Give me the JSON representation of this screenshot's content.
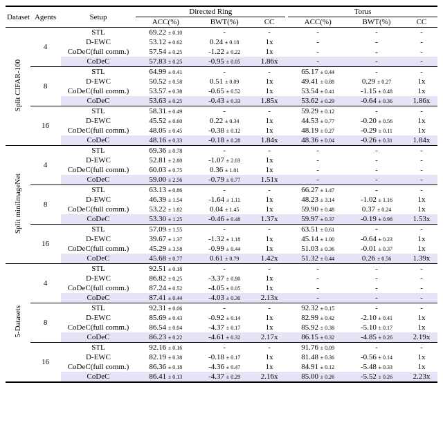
{
  "header": {
    "dataset": "Dataset",
    "agents": "Agents",
    "setup": "Setup",
    "directed_ring": "Directed Ring",
    "torus": "Torus",
    "acc": "ACC(%)",
    "bwt": "BWT(%)",
    "cc": "CC"
  },
  "setups": {
    "stl": "STL",
    "dewc": "D-EWC",
    "codecfull": "CoDeC(full comm.)",
    "codec": "CoDeC"
  },
  "datasets": [
    {
      "name": "Split CIFAR-100",
      "groups": [
        {
          "agents": "4",
          "rows": [
            {
              "setup": "stl",
              "dr_acc": "69.22",
              "dr_acc_pm": "± 0.10",
              "dr_bwt": "-",
              "dr_bwt_pm": "",
              "dr_cc": "-",
              "t_acc": "-",
              "t_acc_pm": "",
              "t_bwt": "-",
              "t_bwt_pm": "",
              "t_cc": "-"
            },
            {
              "setup": "dewc",
              "dr_acc": "53.12",
              "dr_acc_pm": "± 0.62",
              "dr_bwt": "0.24",
              "dr_bwt_pm": "± 0.18",
              "dr_cc": "1x",
              "t_acc": "-",
              "t_acc_pm": "",
              "t_bwt": "-",
              "t_bwt_pm": "",
              "t_cc": "-"
            },
            {
              "setup": "codecfull",
              "dr_acc": "57.54",
              "dr_acc_pm": "± 0.25",
              "dr_bwt": "-1.22",
              "dr_bwt_pm": "± 0.22",
              "dr_cc": "1x",
              "t_acc": "-",
              "t_acc_pm": "",
              "t_bwt": "-",
              "t_bwt_pm": "",
              "t_cc": "-"
            },
            {
              "setup": "codec",
              "hl": true,
              "dr_acc": "57.83",
              "dr_acc_pm": "± 0.25",
              "dr_bwt": "-0.95",
              "dr_bwt_pm": "± 0.05",
              "dr_cc": "1.86x",
              "t_acc": "-",
              "t_acc_pm": "",
              "t_bwt": "-",
              "t_bwt_pm": "",
              "t_cc": "-"
            }
          ]
        },
        {
          "agents": "8",
          "rows": [
            {
              "setup": "stl",
              "dr_acc": "64.99",
              "dr_acc_pm": "± 0.41",
              "dr_bwt": "-",
              "dr_bwt_pm": "",
              "dr_cc": "-",
              "t_acc": "65.17",
              "t_acc_pm": "± 0.44",
              "t_bwt": "-",
              "t_bwt_pm": "",
              "t_cc": "-"
            },
            {
              "setup": "dewc",
              "dr_acc": "50.52",
              "dr_acc_pm": "± 0.58",
              "dr_bwt": "0.51",
              "dr_bwt_pm": "± 0.09",
              "dr_cc": "1x",
              "t_acc": "49.41",
              "t_acc_pm": "± 0.88",
              "t_bwt": "0.29",
              "t_bwt_pm": "± 0.27",
              "t_cc": "1x"
            },
            {
              "setup": "codecfull",
              "dr_acc": "53.57",
              "dr_acc_pm": "± 0.38",
              "dr_bwt": "-0.65",
              "dr_bwt_pm": "± 0.52",
              "dr_cc": "1x",
              "t_acc": "53.54",
              "t_acc_pm": "± 0.41",
              "t_bwt": "-1.15",
              "t_bwt_pm": "± 0.48",
              "t_cc": "1x"
            },
            {
              "setup": "codec",
              "hl": true,
              "dr_acc": "53.63",
              "dr_acc_pm": "± 0.25",
              "dr_bwt": "-0.43",
              "dr_bwt_pm": "± 0.33",
              "dr_cc": "1.85x",
              "t_acc": "53.62",
              "t_acc_pm": "± 0.29",
              "t_bwt": "-0.64",
              "t_bwt_pm": "± 0.36",
              "t_cc": "1.86x"
            }
          ]
        },
        {
          "agents": "16",
          "rows": [
            {
              "setup": "stl",
              "dr_acc": "58.31",
              "dr_acc_pm": "± 0.49",
              "dr_bwt": "-",
              "dr_bwt_pm": "",
              "dr_cc": "-",
              "t_acc": "59.29",
              "t_acc_pm": "± 0.12",
              "t_bwt": "-",
              "t_bwt_pm": "",
              "t_cc": "-"
            },
            {
              "setup": "dewc",
              "dr_acc": "45.52",
              "dr_acc_pm": "± 0.60",
              "dr_bwt": "0.22",
              "dr_bwt_pm": "± 0.34",
              "dr_cc": "1x",
              "t_acc": "44.53",
              "t_acc_pm": "± 0.77",
              "t_bwt": "-0.20",
              "t_bwt_pm": "± 0.56",
              "t_cc": "1x"
            },
            {
              "setup": "codecfull",
              "dr_acc": "48.05",
              "dr_acc_pm": "± 0.45",
              "dr_bwt": "-0.38",
              "dr_bwt_pm": "± 0.12",
              "dr_cc": "1x",
              "t_acc": "48.19",
              "t_acc_pm": "± 0.27",
              "t_bwt": "-0.29",
              "t_bwt_pm": "± 0.11",
              "t_cc": "1x"
            },
            {
              "setup": "codec",
              "hl": true,
              "dr_acc": "48.16",
              "dr_acc_pm": "± 0.33",
              "dr_bwt": "-0.18",
              "dr_bwt_pm": "± 0.28",
              "dr_cc": "1.84x",
              "t_acc": "48.36",
              "t_acc_pm": "± 0.04",
              "t_bwt": "-0.26",
              "t_bwt_pm": "± 0.31",
              "t_cc": "1.84x"
            }
          ]
        }
      ]
    },
    {
      "name": "Split miniImageNet",
      "groups": [
        {
          "agents": "4",
          "rows": [
            {
              "setup": "stl",
              "dr_acc": "69.36",
              "dr_acc_pm": "± 0.78",
              "dr_bwt": "-",
              "dr_bwt_pm": "",
              "dr_cc": "-",
              "t_acc": "-",
              "t_acc_pm": "",
              "t_bwt": "-",
              "t_bwt_pm": "",
              "t_cc": "-"
            },
            {
              "setup": "dewc",
              "dr_acc": "52.81",
              "dr_acc_pm": "± 2.80",
              "dr_bwt": "-1.07",
              "dr_bwt_pm": "± 2.03",
              "dr_cc": "1x",
              "t_acc": "-",
              "t_acc_pm": "",
              "t_bwt": "-",
              "t_bwt_pm": "",
              "t_cc": "-"
            },
            {
              "setup": "codecfull",
              "dr_acc": "60.03",
              "dr_acc_pm": "± 0.75",
              "dr_bwt": "0.36",
              "dr_bwt_pm": "± 1.01",
              "dr_cc": "1x",
              "t_acc": "-",
              "t_acc_pm": "",
              "t_bwt": "-",
              "t_bwt_pm": "",
              "t_cc": "-"
            },
            {
              "setup": "codec",
              "hl": true,
              "dr_acc": "59.00",
              "dr_acc_pm": "± 2.56",
              "dr_bwt": "-0.79",
              "dr_bwt_pm": "± 0.77",
              "dr_cc": "1.51x",
              "t_acc": "-",
              "t_acc_pm": "",
              "t_bwt": "-",
              "t_bwt_pm": "",
              "t_cc": "-"
            }
          ]
        },
        {
          "agents": "8",
          "rows": [
            {
              "setup": "stl",
              "dr_acc": "63.13",
              "dr_acc_pm": "± 0.86",
              "dr_bwt": "-",
              "dr_bwt_pm": "",
              "dr_cc": "-",
              "t_acc": "66.27",
              "t_acc_pm": "± 1.47",
              "t_bwt": "-",
              "t_bwt_pm": "",
              "t_cc": "-"
            },
            {
              "setup": "dewc",
              "dr_acc": "46.39",
              "dr_acc_pm": "± 1.54",
              "dr_bwt": "-1.64",
              "dr_bwt_pm": "± 1.11",
              "dr_cc": "1x",
              "t_acc": "48.23",
              "t_acc_pm": "± 3.14",
              "t_bwt": "-1.02",
              "t_bwt_pm": "± 1.16",
              "t_cc": "1x"
            },
            {
              "setup": "codecfull",
              "dr_acc": "53.22",
              "dr_acc_pm": "± 1.82",
              "dr_bwt": "0.04",
              "dr_bwt_pm": "± 1.45",
              "dr_cc": "1x",
              "t_acc": "59.90",
              "t_acc_pm": "± 0.48",
              "t_bwt": "0.37",
              "t_bwt_pm": "± 0.24",
              "t_cc": "1x"
            },
            {
              "setup": "codec",
              "hl": true,
              "dr_acc": "53.30",
              "dr_acc_pm": "± 1.25",
              "dr_bwt": "-0.46",
              "dr_bwt_pm": "± 0.48",
              "dr_cc": "1.37x",
              "t_acc": "59.97",
              "t_acc_pm": "± 0.37",
              "t_bwt": "-0.19",
              "t_bwt_pm": "± 0.98",
              "t_cc": "1.53x"
            }
          ]
        },
        {
          "agents": "16",
          "rows": [
            {
              "setup": "stl",
              "dr_acc": "57.09",
              "dr_acc_pm": "± 1.55",
              "dr_bwt": "-",
              "dr_bwt_pm": "",
              "dr_cc": "-",
              "t_acc": "63.51",
              "t_acc_pm": "± 0.61",
              "t_bwt": "-",
              "t_bwt_pm": "",
              "t_cc": "-"
            },
            {
              "setup": "dewc",
              "dr_acc": "39.67",
              "dr_acc_pm": "± 1.37",
              "dr_bwt": "-1.32",
              "dr_bwt_pm": "± 1.18",
              "dr_cc": "1x",
              "t_acc": "45.14",
              "t_acc_pm": "± 1.00",
              "t_bwt": "-0.64",
              "t_bwt_pm": "± 0.23",
              "t_cc": "1x"
            },
            {
              "setup": "codecfull",
              "dr_acc": "45.29",
              "dr_acc_pm": "± 3.58",
              "dr_bwt": "-0.99",
              "dr_bwt_pm": "± 0.44",
              "dr_cc": "1x",
              "t_acc": "51.03",
              "t_acc_pm": "± 0.36",
              "t_bwt": "-0.01",
              "t_bwt_pm": "± 0.37",
              "t_cc": "1x"
            },
            {
              "setup": "codec",
              "hl": true,
              "dr_acc": "45.68",
              "dr_acc_pm": "± 0.77",
              "dr_bwt": "0.61",
              "dr_bwt_pm": "± 0.79",
              "dr_cc": "1.42x",
              "t_acc": "51.32",
              "t_acc_pm": "± 0.44",
              "t_bwt": "0.26",
              "t_bwt_pm": "± 0.56",
              "t_cc": "1.39x"
            }
          ]
        }
      ]
    },
    {
      "name": "5-Datasets",
      "groups": [
        {
          "agents": "4",
          "rows": [
            {
              "setup": "stl",
              "dr_acc": "92.51",
              "dr_acc_pm": "± 0.18",
              "dr_bwt": "-",
              "dr_bwt_pm": "",
              "dr_cc": "-",
              "t_acc": "-",
              "t_acc_pm": "",
              "t_bwt": "-",
              "t_bwt_pm": "",
              "t_cc": "-"
            },
            {
              "setup": "dewc",
              "dr_acc": "86.82",
              "dr_acc_pm": "± 0.25",
              "dr_bwt": "-3.37",
              "dr_bwt_pm": "± 0.80",
              "dr_cc": "1x",
              "t_acc": "-",
              "t_acc_pm": "",
              "t_bwt": "-",
              "t_bwt_pm": "",
              "t_cc": "-"
            },
            {
              "setup": "codecfull",
              "dr_acc": "87.24",
              "dr_acc_pm": "± 0.52",
              "dr_bwt": "-4.05",
              "dr_bwt_pm": "± 0.05",
              "dr_cc": "1x",
              "t_acc": "-",
              "t_acc_pm": "",
              "t_bwt": "-",
              "t_bwt_pm": "",
              "t_cc": "-"
            },
            {
              "setup": "codec",
              "hl": true,
              "dr_acc": "87.41",
              "dr_acc_pm": "± 0.44",
              "dr_bwt": "-4.03",
              "dr_bwt_pm": "± 0.30",
              "dr_cc": "2.13x",
              "t_acc": "-",
              "t_acc_pm": "",
              "t_bwt": "-",
              "t_bwt_pm": "",
              "t_cc": "-"
            }
          ]
        },
        {
          "agents": "8",
          "rows": [
            {
              "setup": "stl",
              "dr_acc": "92.31",
              "dr_acc_pm": "± 0.06",
              "dr_bwt": "-",
              "dr_bwt_pm": "",
              "dr_cc": "-",
              "t_acc": "92.32",
              "t_acc_pm": "± 0.15",
              "t_bwt": "-",
              "t_bwt_pm": "",
              "t_cc": "-"
            },
            {
              "setup": "dewc",
              "dr_acc": "85.69",
              "dr_acc_pm": "± 0.43",
              "dr_bwt": "-0.92",
              "dr_bwt_pm": "± 0.14",
              "dr_cc": "1x",
              "t_acc": "82.99",
              "t_acc_pm": "± 0.42",
              "t_bwt": "-2.10",
              "t_bwt_pm": "± 0.41",
              "t_cc": "1x"
            },
            {
              "setup": "codecfull",
              "dr_acc": "86.54",
              "dr_acc_pm": "± 0.04",
              "dr_bwt": "-4.37",
              "dr_bwt_pm": "± 0.17",
              "dr_cc": "1x",
              "t_acc": "85.92",
              "t_acc_pm": "± 0.38",
              "t_bwt": "-5.10",
              "t_bwt_pm": "± 0.17",
              "t_cc": "1x"
            },
            {
              "setup": "codec",
              "hl": true,
              "dr_acc": "86.23",
              "dr_acc_pm": "± 0.22",
              "dr_bwt": "-4.61",
              "dr_bwt_pm": "± 0.32",
              "dr_cc": "2.17x",
              "t_acc": "86.15",
              "t_acc_pm": "± 0.32",
              "t_bwt": "-4.85",
              "t_bwt_pm": "± 0.26",
              "t_cc": "2.19x"
            }
          ]
        },
        {
          "agents": "16",
          "rows": [
            {
              "setup": "stl",
              "dr_acc": "92.16",
              "dr_acc_pm": "± 0.16",
              "dr_bwt": "-",
              "dr_bwt_pm": "",
              "dr_cc": "-",
              "t_acc": "91.76",
              "t_acc_pm": "± 0.09",
              "t_bwt": "-",
              "t_bwt_pm": "",
              "t_cc": "-"
            },
            {
              "setup": "dewc",
              "dr_acc": "82.19",
              "dr_acc_pm": "± 0.38",
              "dr_bwt": "-0.18",
              "dr_bwt_pm": "± 0.17",
              "dr_cc": "1x",
              "t_acc": "81.48",
              "t_acc_pm": "± 0.36",
              "t_bwt": "-0.56",
              "t_bwt_pm": "± 0.14",
              "t_cc": "1x"
            },
            {
              "setup": "codecfull",
              "dr_acc": "86.36",
              "dr_acc_pm": "± 0.18",
              "dr_bwt": "-4.36",
              "dr_bwt_pm": "± 0.47",
              "dr_cc": "1x",
              "t_acc": "84.91",
              "t_acc_pm": "± 0.12",
              "t_bwt": "-5.48",
              "t_bwt_pm": "± 0.33",
              "t_cc": "1x"
            },
            {
              "setup": "codec",
              "hl": true,
              "dr_acc": "86.41",
              "dr_acc_pm": "± 0.13",
              "dr_bwt": "-4.37",
              "dr_bwt_pm": "± 0.29",
              "dr_cc": "2.16x",
              "t_acc": "85.00",
              "t_acc_pm": "± 0.26",
              "t_bwt": "-5.52",
              "t_bwt_pm": "± 0.26",
              "t_cc": "2.23x"
            }
          ]
        }
      ]
    }
  ]
}
